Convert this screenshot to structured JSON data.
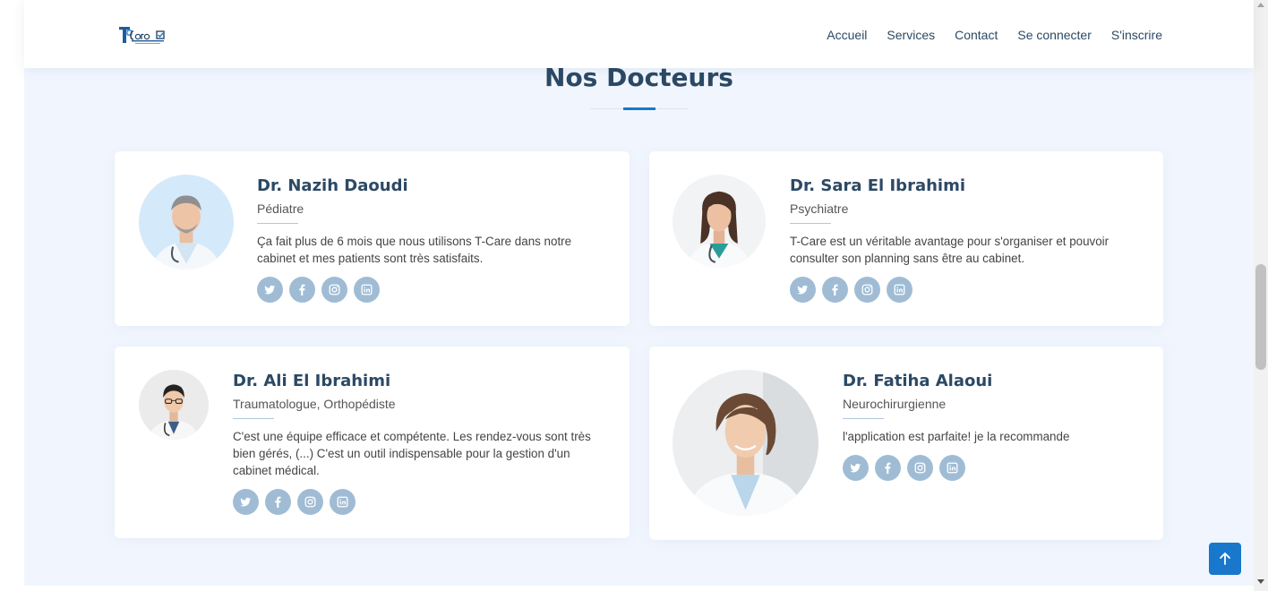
{
  "header": {
    "logo_alt": "T-Care",
    "nav": [
      "Accueil",
      "Services",
      "Contact",
      "Se connecter",
      "S'inscrire"
    ]
  },
  "section": {
    "title": "Nos Docteurs"
  },
  "doctors": [
    {
      "name": "Dr. Nazih Daoudi",
      "role": "Pédiatre",
      "quote": "Ça fait plus de 6 mois que nous utilisons T-Care dans notre cabinet et mes patients sont très satisfaits.",
      "photo": "doctor-male-photo"
    },
    {
      "name": "Dr. Sara El Ibrahimi",
      "role": "Psychiatre",
      "quote": "T-Care est un véritable avantage pour s'organiser et pouvoir consulter son planning sans être au cabinet.",
      "photo": "doctor-female-photo"
    },
    {
      "name": "Dr. Ali El Ibrahimi",
      "role": "Traumatologue, Orthopédiste",
      "quote": "C'est une équipe efficace et compétente. Les rendez-vous sont très bien gérés, (...) C'est un outil indispensable pour la gestion d'un cabinet médical.",
      "photo": "doctor-male-photo"
    },
    {
      "name": "Dr. Fatiha Alaoui",
      "role": "Neurochirurgienne",
      "quote": "l'application est parfaite! je la recommande",
      "photo": "doctor-female-photo"
    }
  ],
  "social_icons": [
    "twitter-icon",
    "facebook-icon",
    "instagram-icon",
    "linkedin-icon"
  ],
  "colors": {
    "primary": "#1977cc",
    "heading": "#2c4964",
    "background": "#f1f6fe",
    "social": "#a0bcd5"
  },
  "back_to_top": "arrow-up-icon"
}
